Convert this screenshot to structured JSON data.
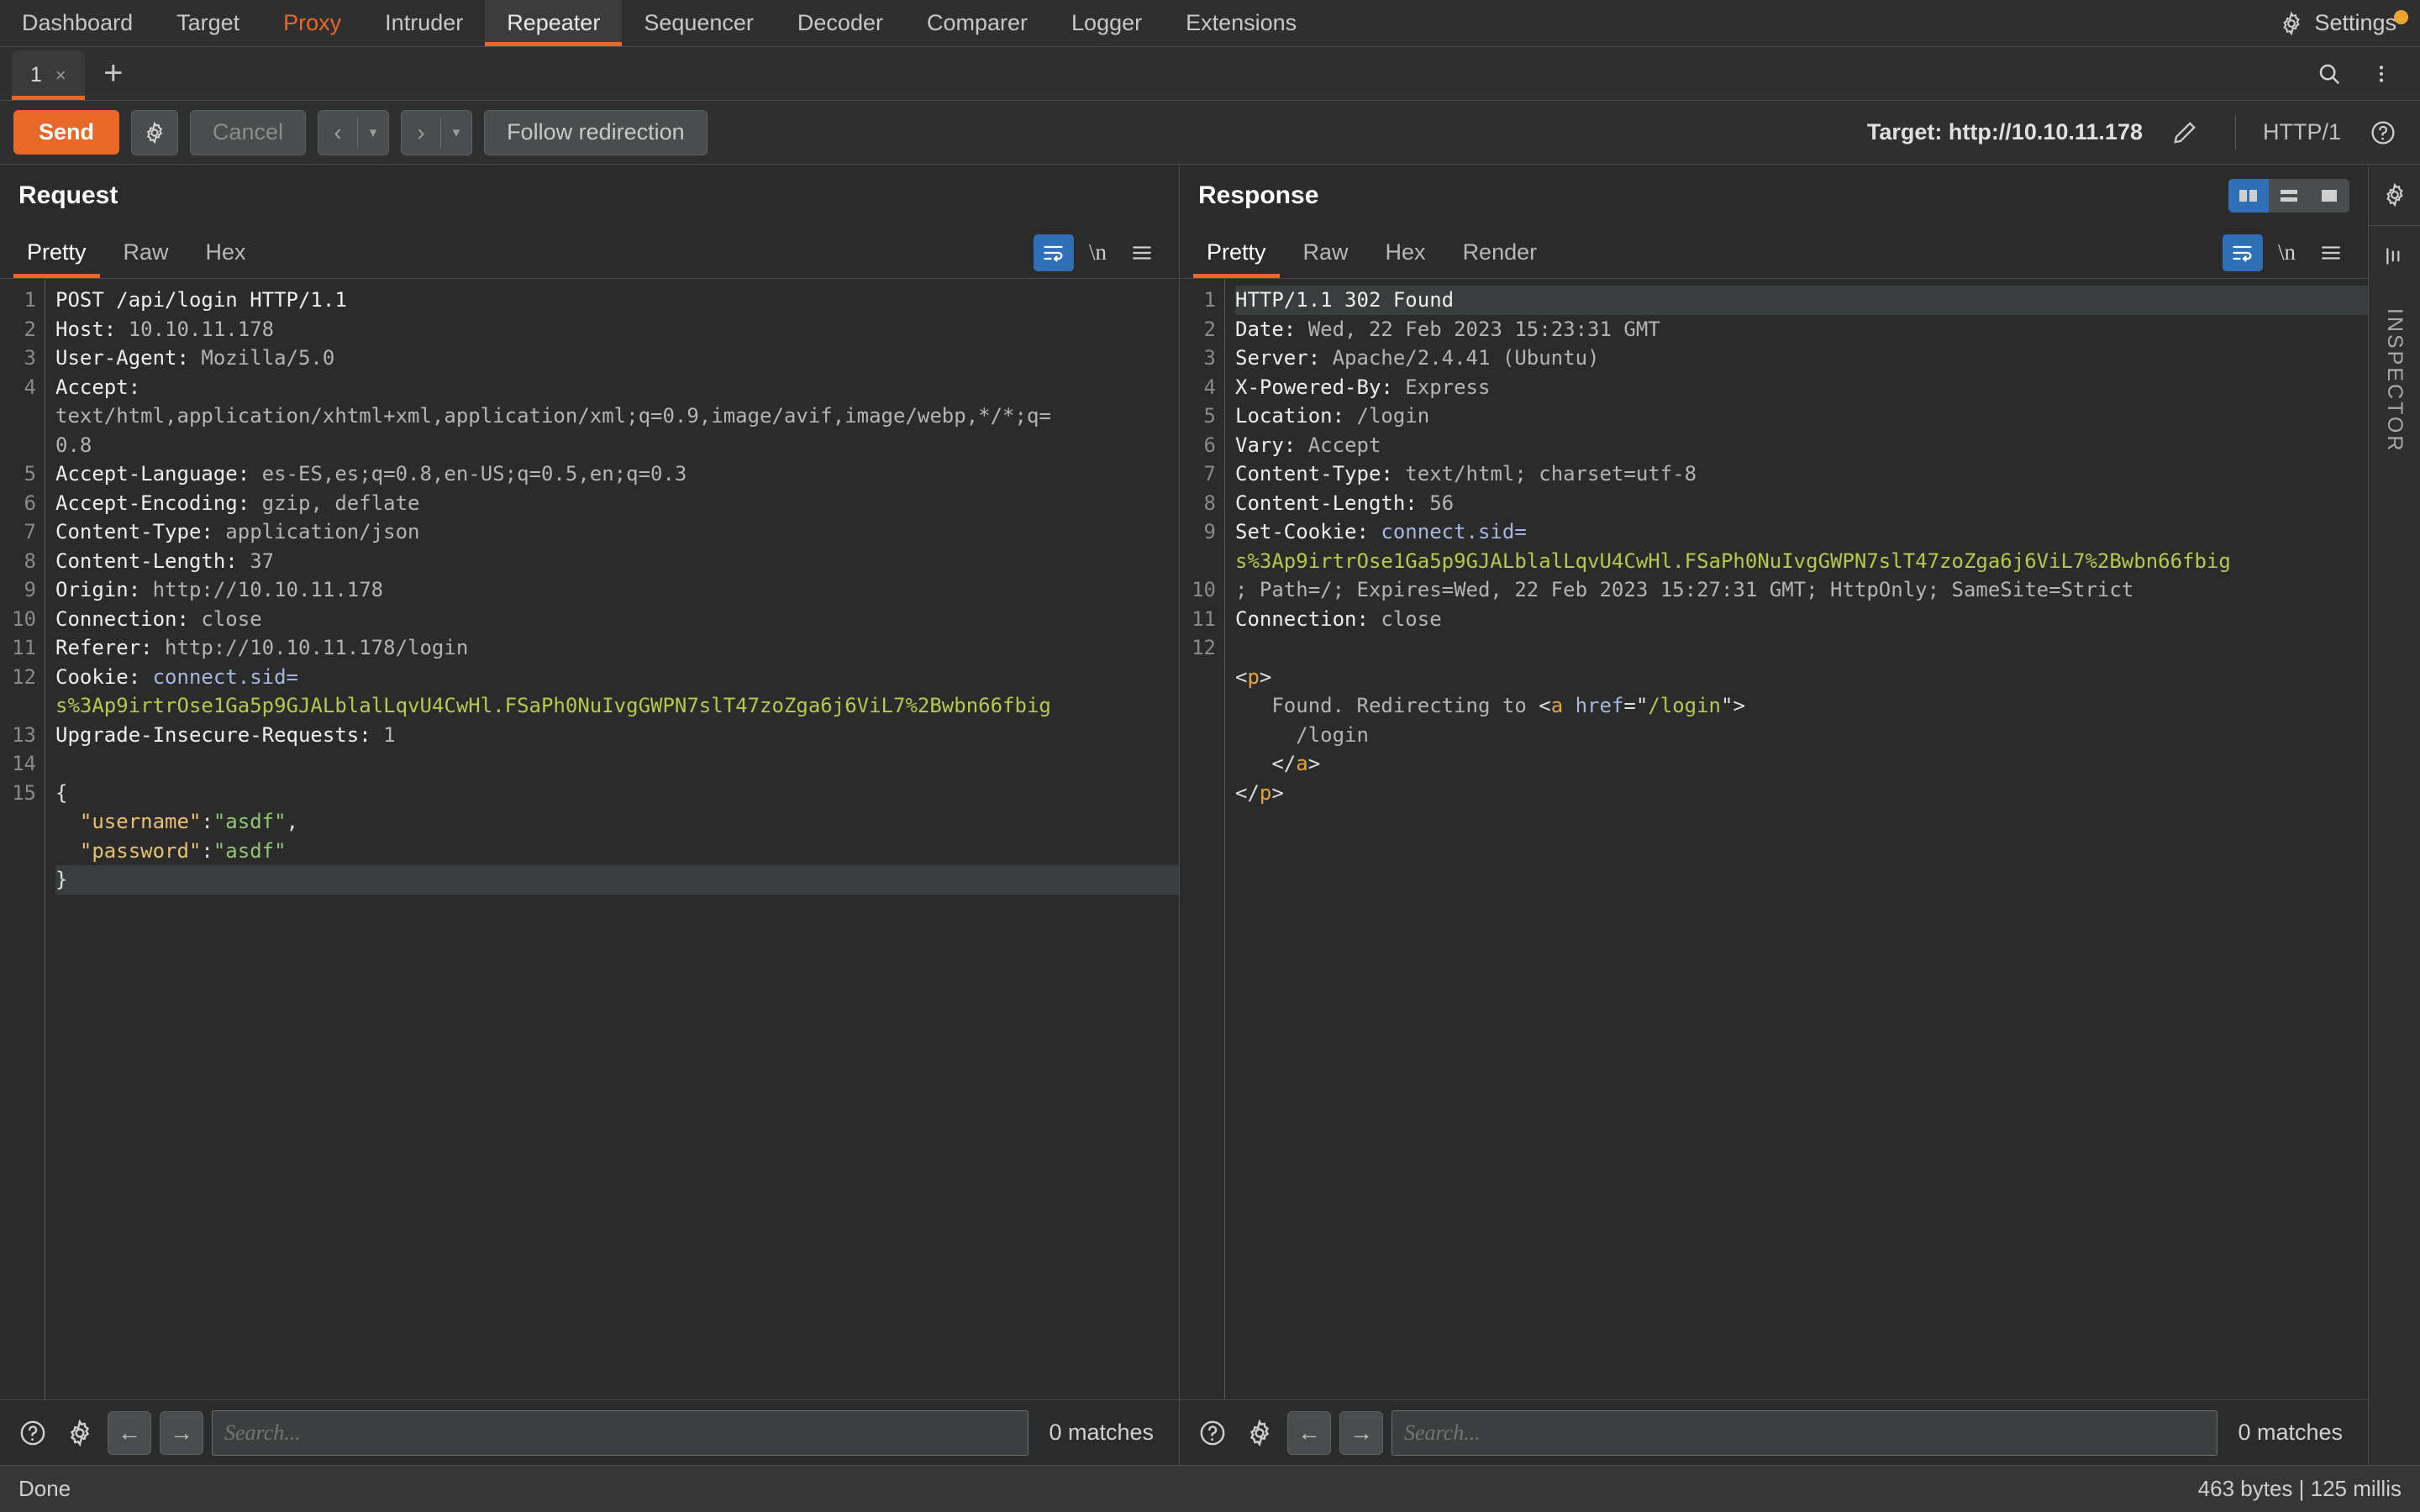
{
  "app": {
    "nav_items": [
      {
        "label": "Dashboard",
        "state": "normal"
      },
      {
        "label": "Target",
        "state": "normal"
      },
      {
        "label": "Proxy",
        "state": "alert"
      },
      {
        "label": "Intruder",
        "state": "normal"
      },
      {
        "label": "Repeater",
        "state": "active"
      },
      {
        "label": "Sequencer",
        "state": "normal"
      },
      {
        "label": "Decoder",
        "state": "normal"
      },
      {
        "label": "Comparer",
        "state": "normal"
      },
      {
        "label": "Logger",
        "state": "normal"
      },
      {
        "label": "Extensions",
        "state": "normal"
      }
    ],
    "settings_label": "Settings",
    "settings_icon": "gear-icon",
    "settings_badge_color": "#f0a430",
    "accent_color": "#e8682a",
    "select_color": "#2f6fb5"
  },
  "tabstrip": {
    "tabs": [
      {
        "label": "1",
        "close": "×"
      }
    ],
    "add_label": "+",
    "search_icon": "search-icon",
    "menu_icon": "kebab-menu-icon"
  },
  "actionbar": {
    "send_label": "Send",
    "settings_icon": "gear-icon",
    "cancel_label": "Cancel",
    "back_glyph": "‹",
    "forward_glyph": "›",
    "caret_glyph": "▾",
    "follow_redirection_label": "Follow redirection",
    "target_label": "Target: http://10.10.11.178",
    "edit_icon": "pencil-icon",
    "http_version": "HTTP/1",
    "help_icon": "help-circle-icon"
  },
  "request": {
    "title": "Request",
    "tabs": [
      {
        "label": "Pretty",
        "active": true
      },
      {
        "label": "Raw",
        "active": false
      },
      {
        "label": "Hex",
        "active": false
      }
    ],
    "wrap_icon": "word-wrap-icon",
    "newline_label": "\\n",
    "menu_icon": "hamburger-menu-icon",
    "gutter": [
      "1",
      "2",
      "3",
      "4",
      "",
      "",
      "5",
      "6",
      "7",
      "8",
      "9",
      "10",
      "11",
      "12",
      "",
      "13",
      "14",
      "15",
      "",
      "",
      ""
    ],
    "lines": [
      {
        "parts": [
          {
            "t": "POST /api/login HTTP/1.1",
            "c": "hk"
          }
        ]
      },
      {
        "parts": [
          {
            "t": "Host: ",
            "c": "hk"
          },
          {
            "t": "10.10.11.178",
            "c": "hv"
          }
        ]
      },
      {
        "parts": [
          {
            "t": "User-Agent: ",
            "c": "hk"
          },
          {
            "t": "Mozilla/5.0",
            "c": "hv"
          }
        ]
      },
      {
        "parts": [
          {
            "t": "Accept: ",
            "c": "hk"
          }
        ]
      },
      {
        "parts": [
          {
            "t": "text/html,application/xhtml+xml,application/xml;q=0.9,image/avif,image/webp,*/*;q=",
            "c": "hv"
          }
        ]
      },
      {
        "parts": [
          {
            "t": "0.8",
            "c": "hv"
          }
        ]
      },
      {
        "parts": [
          {
            "t": "Accept-Language: ",
            "c": "hk"
          },
          {
            "t": "es-ES,es;q=0.8,en-US;q=0.5,en;q=0.3",
            "c": "hv"
          }
        ]
      },
      {
        "parts": [
          {
            "t": "Accept-Encoding: ",
            "c": "hk"
          },
          {
            "t": "gzip, deflate",
            "c": "hv"
          }
        ]
      },
      {
        "parts": [
          {
            "t": "Content-Type: ",
            "c": "hk"
          },
          {
            "t": "application/json",
            "c": "hv"
          }
        ]
      },
      {
        "parts": [
          {
            "t": "Content-Length: ",
            "c": "hk"
          },
          {
            "t": "37",
            "c": "hv"
          }
        ]
      },
      {
        "parts": [
          {
            "t": "Origin: ",
            "c": "hk"
          },
          {
            "t": "http://10.10.11.178",
            "c": "hv"
          }
        ]
      },
      {
        "parts": [
          {
            "t": "Connection: ",
            "c": "hk"
          },
          {
            "t": "close",
            "c": "hv"
          }
        ]
      },
      {
        "parts": [
          {
            "t": "Referer: ",
            "c": "hk"
          },
          {
            "t": "http://10.10.11.178/login",
            "c": "hv"
          }
        ]
      },
      {
        "parts": [
          {
            "t": "Cookie: ",
            "c": "hk"
          },
          {
            "t": "connect.sid=",
            "c": "ckn"
          }
        ]
      },
      {
        "parts": [
          {
            "t": "s%3Ap9irtrOse1Ga5p9GJALblalLqvU4CwHl.FSaPh0NuIvgGWPN7slT47zoZga6j6ViL7%2Bwbn66fbig",
            "c": "ckv"
          }
        ]
      },
      {
        "parts": [
          {
            "t": "Upgrade-Insecure-Requests: ",
            "c": "hk"
          },
          {
            "t": "1",
            "c": "hv"
          }
        ]
      },
      {
        "parts": [
          {
            "t": "",
            "c": "plain"
          }
        ]
      },
      {
        "parts": [
          {
            "t": "{",
            "c": "punct"
          }
        ]
      },
      {
        "parts": [
          {
            "t": "  ",
            "c": "plain"
          },
          {
            "t": "\"username\"",
            "c": "jk"
          },
          {
            "t": ":",
            "c": "punct"
          },
          {
            "t": "\"asdf\"",
            "c": "jv"
          },
          {
            "t": ",",
            "c": "punct"
          }
        ]
      },
      {
        "parts": [
          {
            "t": "  ",
            "c": "plain"
          },
          {
            "t": "\"password\"",
            "c": "jk"
          },
          {
            "t": ":",
            "c": "punct"
          },
          {
            "t": "\"asdf\"",
            "c": "jv"
          }
        ]
      },
      {
        "parts": [
          {
            "t": "}",
            "c": "punct"
          }
        ],
        "caret": true
      }
    ],
    "search_placeholder": "Search...",
    "matches_label": "0 matches",
    "help_icon": "help-circle-icon",
    "gear_icon": "gear-icon",
    "prev_glyph": "←",
    "next_glyph": "→"
  },
  "response": {
    "title": "Response",
    "tabs": [
      {
        "label": "Pretty",
        "active": true
      },
      {
        "label": "Raw",
        "active": false
      },
      {
        "label": "Hex",
        "active": false
      },
      {
        "label": "Render",
        "active": false
      }
    ],
    "layout_buttons": [
      {
        "icon": "split-vertical-icon",
        "selected": true
      },
      {
        "icon": "split-horizontal-icon",
        "selected": false
      },
      {
        "icon": "single-pane-icon",
        "selected": false
      }
    ],
    "wrap_icon": "word-wrap-icon",
    "newline_label": "\\n",
    "menu_icon": "hamburger-menu-icon",
    "gutter": [
      "1",
      "2",
      "3",
      "4",
      "5",
      "6",
      "7",
      "8",
      "9",
      "",
      "10",
      "11",
      "12",
      "",
      "",
      "",
      ""
    ],
    "lines": [
      {
        "parts": [
          {
            "t": "HTTP/1.1 302 Found",
            "c": "hk"
          }
        ],
        "caret": true
      },
      {
        "parts": [
          {
            "t": "Date: ",
            "c": "hk"
          },
          {
            "t": "Wed, 22 Feb 2023 15:23:31 GMT",
            "c": "hv"
          }
        ]
      },
      {
        "parts": [
          {
            "t": "Server: ",
            "c": "hk"
          },
          {
            "t": "Apache/2.4.41 (Ubuntu)",
            "c": "hv"
          }
        ]
      },
      {
        "parts": [
          {
            "t": "X-Powered-By: ",
            "c": "hk"
          },
          {
            "t": "Express",
            "c": "hv"
          }
        ]
      },
      {
        "parts": [
          {
            "t": "Location: ",
            "c": "hk"
          },
          {
            "t": "/login",
            "c": "hv"
          }
        ]
      },
      {
        "parts": [
          {
            "t": "Vary: ",
            "c": "hk"
          },
          {
            "t": "Accept",
            "c": "hv"
          }
        ]
      },
      {
        "parts": [
          {
            "t": "Content-Type: ",
            "c": "hk"
          },
          {
            "t": "text/html; charset=utf-8",
            "c": "hv"
          }
        ]
      },
      {
        "parts": [
          {
            "t": "Content-Length: ",
            "c": "hk"
          },
          {
            "t": "56",
            "c": "hv"
          }
        ]
      },
      {
        "parts": [
          {
            "t": "Set-Cookie: ",
            "c": "hk"
          },
          {
            "t": "connect.sid=",
            "c": "ckn"
          }
        ]
      },
      {
        "parts": [
          {
            "t": "s%3Ap9irtrOse1Ga5p9GJALblalLqvU4CwHl.FSaPh0NuIvgGWPN7slT47zoZga6j6ViL7%2Bwbn66fbig",
            "c": "ckv"
          }
        ]
      },
      {
        "parts": [
          {
            "t": "; Path=/; Expires=Wed, 22 Feb 2023 15:27:31 GMT; HttpOnly; SameSite=Strict",
            "c": "hv"
          }
        ]
      },
      {
        "parts": [
          {
            "t": "Connection: ",
            "c": "hk"
          },
          {
            "t": "close",
            "c": "hv"
          }
        ]
      },
      {
        "parts": [
          {
            "t": "",
            "c": "plain"
          }
        ]
      },
      {
        "parts": [
          {
            "t": "<",
            "c": "punct"
          },
          {
            "t": "p",
            "c": "tag"
          },
          {
            "t": ">",
            "c": "punct"
          }
        ]
      },
      {
        "parts": [
          {
            "t": "   Found. Redirecting to ",
            "c": "hv"
          },
          {
            "t": "<",
            "c": "punct"
          },
          {
            "t": "a",
            "c": "tag"
          },
          {
            "t": " ",
            "c": "plain"
          },
          {
            "t": "href",
            "c": "attr"
          },
          {
            "t": "=\"",
            "c": "punct"
          },
          {
            "t": "/login",
            "c": "attrv"
          },
          {
            "t": "\">",
            "c": "punct"
          }
        ]
      },
      {
        "parts": [
          {
            "t": "     /login",
            "c": "hv"
          }
        ]
      },
      {
        "parts": [
          {
            "t": "   ",
            "c": "plain"
          },
          {
            "t": "</",
            "c": "punct"
          },
          {
            "t": "a",
            "c": "tag"
          },
          {
            "t": ">",
            "c": "punct"
          }
        ]
      },
      {
        "parts": [
          {
            "t": "</",
            "c": "punct"
          },
          {
            "t": "p",
            "c": "tag"
          },
          {
            "t": ">",
            "c": "punct"
          }
        ]
      }
    ],
    "search_placeholder": "Search...",
    "matches_label": "0 matches",
    "help_icon": "help-circle-icon",
    "gear_icon": "gear-icon",
    "prev_glyph": "←",
    "next_glyph": "→"
  },
  "inspector": {
    "gear_icon": "gear-icon",
    "panel_icon": "panel-layout-icon",
    "label": "INSPECTOR"
  },
  "statusbar": {
    "status": "Done",
    "metrics": "463 bytes | 125 millis"
  }
}
